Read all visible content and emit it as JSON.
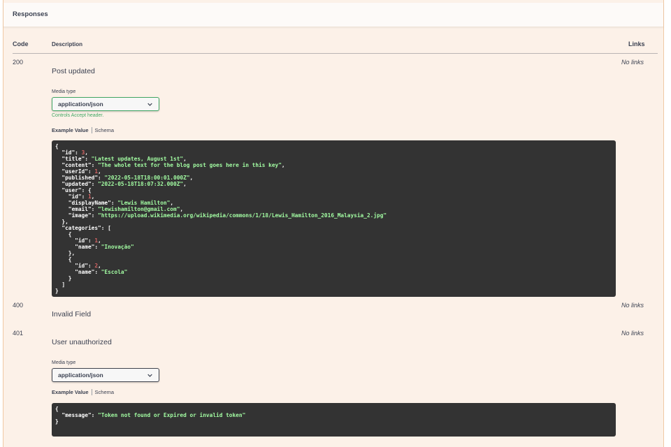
{
  "panel": {
    "title": "Responses",
    "columns": {
      "code": "Code",
      "description": "Description",
      "links": "Links"
    }
  },
  "responses": [
    {
      "code": "200",
      "description": "Post updated",
      "links": "No links",
      "media_label": "Media type",
      "media_value": "application/json",
      "accept_note": "Controls Accept header.",
      "tab_example": "Example Value",
      "tab_schema": "Schema",
      "example_lines": [
        [
          [
            "p",
            "{"
          ]
        ],
        [
          [
            "p",
            "  "
          ],
          [
            "k",
            "\"id\""
          ],
          [
            "p",
            ": "
          ],
          [
            "n",
            "3"
          ],
          [
            "p",
            ","
          ]
        ],
        [
          [
            "p",
            "  "
          ],
          [
            "k",
            "\"title\""
          ],
          [
            "p",
            ": "
          ],
          [
            "s",
            "\"Latest updates, August 1st\""
          ],
          [
            "p",
            ","
          ]
        ],
        [
          [
            "p",
            "  "
          ],
          [
            "k",
            "\"content\""
          ],
          [
            "p",
            ": "
          ],
          [
            "s",
            "\"The whole text for the blog post goes here in this key\""
          ],
          [
            "p",
            ","
          ]
        ],
        [
          [
            "p",
            "  "
          ],
          [
            "k",
            "\"userId\""
          ],
          [
            "p",
            ": "
          ],
          [
            "n",
            "1"
          ],
          [
            "p",
            ","
          ]
        ],
        [
          [
            "p",
            "  "
          ],
          [
            "k",
            "\"published\""
          ],
          [
            "p",
            ": "
          ],
          [
            "s",
            "\"2022-05-18T18:00:01.000Z\""
          ],
          [
            "p",
            ","
          ]
        ],
        [
          [
            "p",
            "  "
          ],
          [
            "k",
            "\"updated\""
          ],
          [
            "p",
            ": "
          ],
          [
            "s",
            "\"2022-05-18T18:07:32.000Z\""
          ],
          [
            "p",
            ","
          ]
        ],
        [
          [
            "p",
            "  "
          ],
          [
            "k",
            "\"user\""
          ],
          [
            "p",
            ": {"
          ]
        ],
        [
          [
            "p",
            "    "
          ],
          [
            "k",
            "\"id\""
          ],
          [
            "p",
            ": "
          ],
          [
            "n",
            "1"
          ],
          [
            "p",
            ","
          ]
        ],
        [
          [
            "p",
            "    "
          ],
          [
            "k",
            "\"displayName\""
          ],
          [
            "p",
            ": "
          ],
          [
            "s",
            "\"Lewis Hamilton\""
          ],
          [
            "p",
            ","
          ]
        ],
        [
          [
            "p",
            "    "
          ],
          [
            "k",
            "\"email\""
          ],
          [
            "p",
            ": "
          ],
          [
            "s",
            "\"lewishamilton@gmail.com\""
          ],
          [
            "p",
            ","
          ]
        ],
        [
          [
            "p",
            "    "
          ],
          [
            "k",
            "\"image\""
          ],
          [
            "p",
            ": "
          ],
          [
            "s",
            "\"https://upload.wikimedia.org/wikipedia/commons/1/18/Lewis_Hamilton_2016_Malaysia_2.jpg\""
          ]
        ],
        [
          [
            "p",
            "  },"
          ]
        ],
        [
          [
            "p",
            "  "
          ],
          [
            "k",
            "\"categories\""
          ],
          [
            "p",
            ": ["
          ]
        ],
        [
          [
            "p",
            "    {"
          ]
        ],
        [
          [
            "p",
            "      "
          ],
          [
            "k",
            "\"id\""
          ],
          [
            "p",
            ": "
          ],
          [
            "n",
            "1"
          ],
          [
            "p",
            ","
          ]
        ],
        [
          [
            "p",
            "      "
          ],
          [
            "k",
            "\"name\""
          ],
          [
            "p",
            ": "
          ],
          [
            "s",
            "\"Inovação\""
          ]
        ],
        [
          [
            "p",
            "    },"
          ]
        ],
        [
          [
            "p",
            "    {"
          ]
        ],
        [
          [
            "p",
            "      "
          ],
          [
            "k",
            "\"id\""
          ],
          [
            "p",
            ": "
          ],
          [
            "n",
            "2"
          ],
          [
            "p",
            ","
          ]
        ],
        [
          [
            "p",
            "      "
          ],
          [
            "k",
            "\"name\""
          ],
          [
            "p",
            ": "
          ],
          [
            "s",
            "\"Escola\""
          ]
        ],
        [
          [
            "p",
            "    }"
          ]
        ],
        [
          [
            "p",
            "  ]"
          ]
        ],
        [
          [
            "p",
            "}"
          ]
        ]
      ]
    },
    {
      "code": "400",
      "description": "Invalid Field",
      "links": "No links"
    },
    {
      "code": "401",
      "description": "User unauthorized",
      "links": "No links",
      "media_label": "Media type",
      "media_value": "application/json",
      "tab_example": "Example Value",
      "tab_schema": "Schema",
      "example_lines": [
        [
          [
            "p",
            "{"
          ]
        ],
        [
          [
            "p",
            "  "
          ],
          [
            "k",
            "\"message\""
          ],
          [
            "p",
            ": "
          ],
          [
            "s",
            "\"Token not found or Expired or invalid token\""
          ]
        ],
        [
          [
            "p",
            "}"
          ]
        ]
      ]
    }
  ],
  "colors": {
    "panel_bg": "#fcf1e8",
    "code_bg": "#333333",
    "string": "#a2fca2",
    "number": "#d36363",
    "accept_green": "#41a663"
  }
}
